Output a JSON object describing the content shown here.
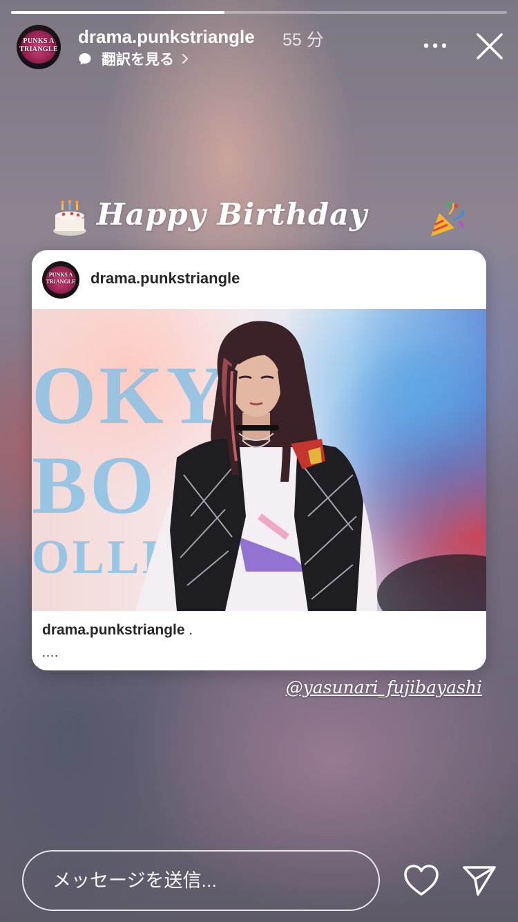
{
  "story": {
    "progress_fraction": 0.43,
    "username": "drama.punkstriangle",
    "time_ago": "55 分",
    "translate_label": "翻訳を見る",
    "avatar_logo_text": "PUNKS A TRIANGLE"
  },
  "sticker": {
    "text": "Happy Birthday"
  },
  "post_card": {
    "username": "drama.punkstriangle",
    "caption_username": "drama.punkstriangle",
    "caption_suffix": " .",
    "caption_more": "....",
    "photo_background_letters": [
      "OKYO",
      "BO",
      "OLLE"
    ]
  },
  "mention": "@yasunari_fujibayashi",
  "footer": {
    "message_placeholder": "メッセージを送信..."
  },
  "icons": {
    "more": "more-horizontal-icon",
    "close": "close-icon",
    "heart": "heart-icon",
    "send": "send-icon",
    "translate": "speech-bubble-icon"
  }
}
